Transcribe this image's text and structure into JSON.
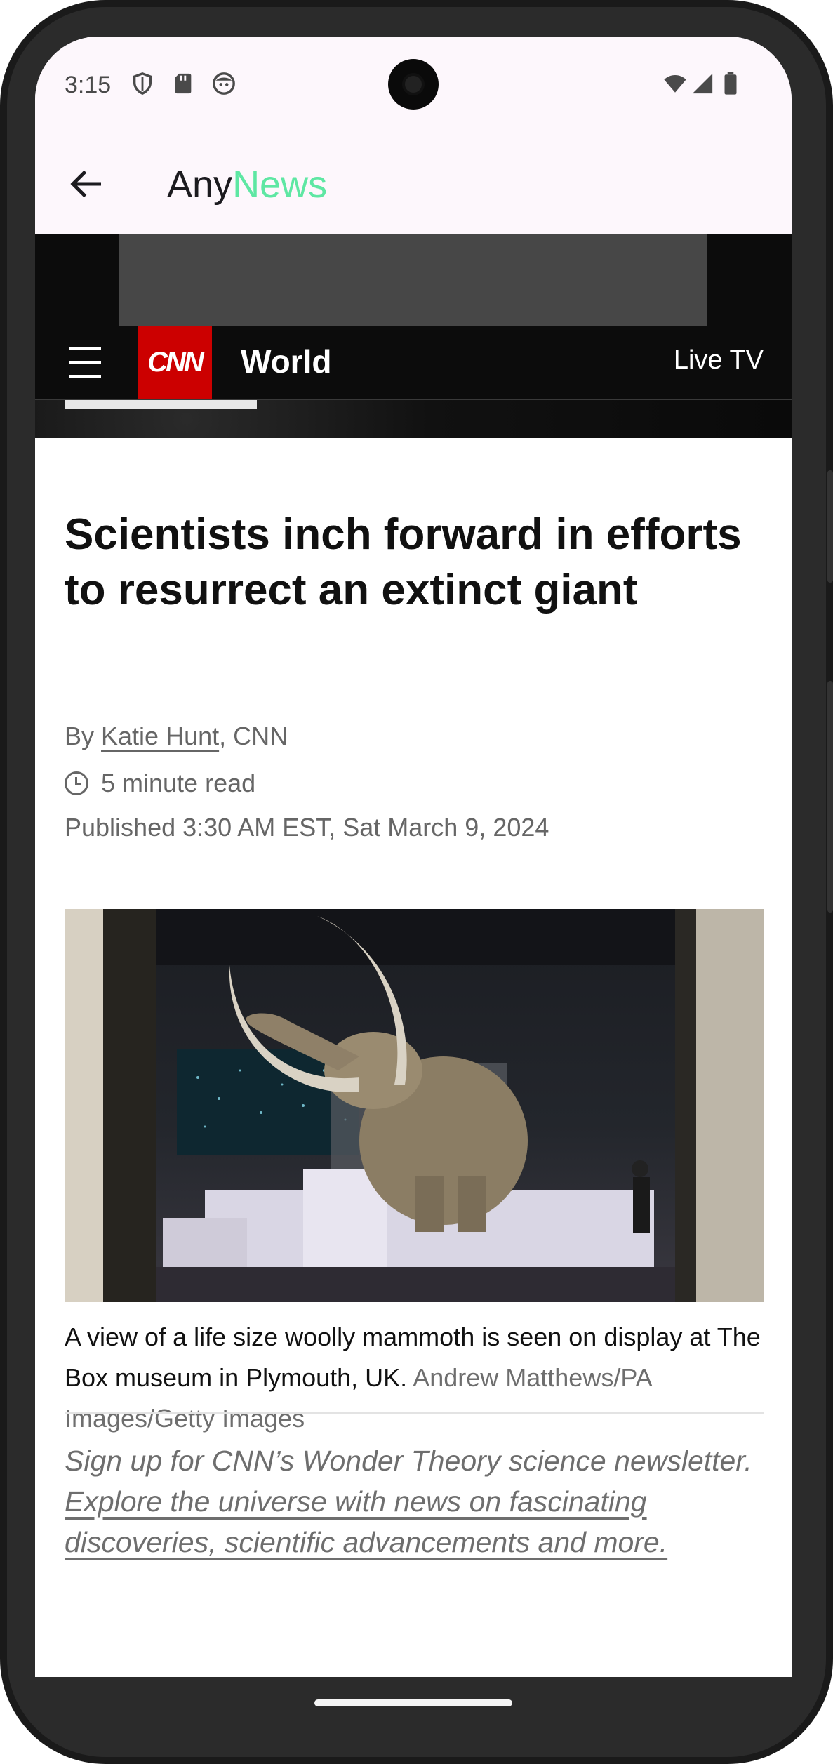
{
  "status_bar": {
    "time": "3:15",
    "icons": [
      "shield-icon",
      "sd-card-icon",
      "face-icon",
      "wifi-icon",
      "signal-icon",
      "battery-icon"
    ]
  },
  "app_bar": {
    "title_part1": "Any",
    "title_part2": "News",
    "accent_color": "#5ee7a3"
  },
  "site_header": {
    "logo_text": "CNN",
    "section": "World",
    "live_tv": "Live TV",
    "brand_color": "#cc0000"
  },
  "article": {
    "headline": "Scientists inch forward in efforts to resurrect an extinct giant",
    "by_prefix": "By ",
    "author": "Katie Hunt",
    "by_suffix": ", CNN",
    "read_time": "5 minute read",
    "published": "Published 3:30 AM EST, Sat March 9, 2024",
    "caption_text": "A view of a life size woolly mammoth is seen on display at The Box museum in Plymouth, UK. ",
    "caption_credit": "Andrew Matthews/PA Images/Getty Images",
    "promo_text": "Sign up for CNN’s Wonder Theory science newsletter. ",
    "promo_link": "Explore the universe with news on fascinating discoveries, scientific advancements and more."
  }
}
